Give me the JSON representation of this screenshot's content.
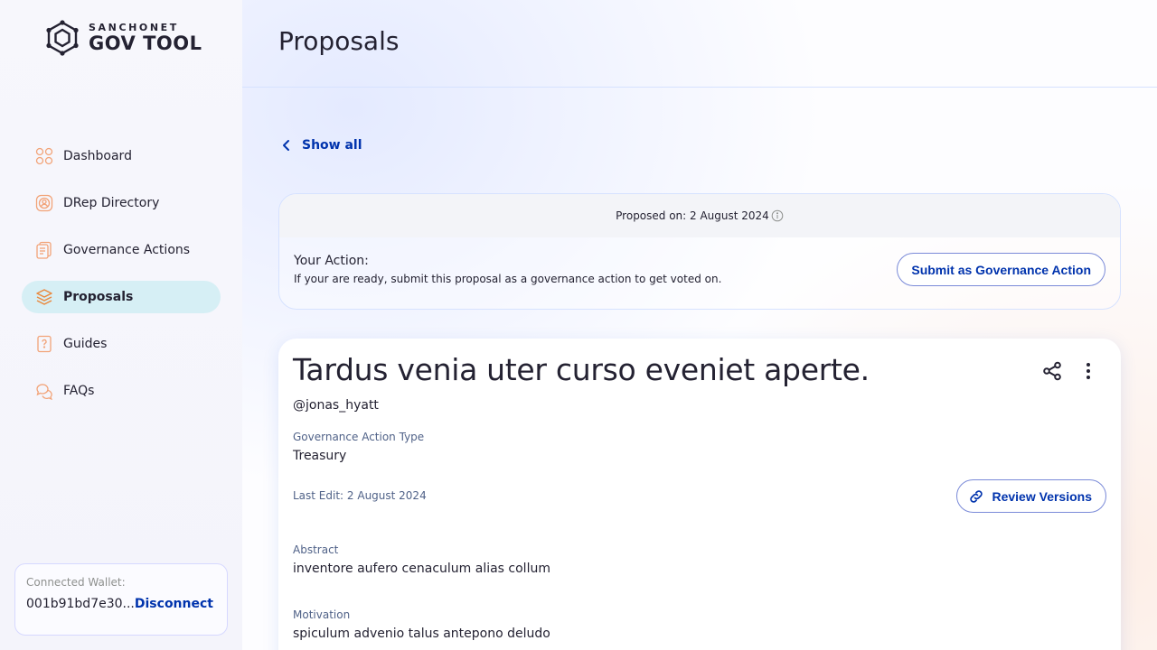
{
  "logo": {
    "subtitle": "SANCHONET",
    "title": "GOV TOOL"
  },
  "sidebar": {
    "items": [
      {
        "label": "Dashboard",
        "icon": "dashboard-icon"
      },
      {
        "label": "DRep Directory",
        "icon": "drep-directory-icon"
      },
      {
        "label": "Governance Actions",
        "icon": "governance-actions-icon"
      },
      {
        "label": "Proposals",
        "icon": "proposals-icon",
        "active": true
      },
      {
        "label": "Guides",
        "icon": "guides-icon"
      },
      {
        "label": "FAQs",
        "icon": "faqs-icon"
      }
    ]
  },
  "wallet": {
    "label": "Connected Wallet:",
    "address": "001b91bd7e30...",
    "disconnect": "Disconnect"
  },
  "header": {
    "title": "Proposals"
  },
  "back": {
    "label": "Show all"
  },
  "action_card": {
    "proposed_on": "Proposed on: 2 August 2024",
    "title": "Your Action:",
    "description": "If your are ready, submit this proposal as a governance action to get voted on.",
    "submit_label": "Submit as Governance Action"
  },
  "proposal": {
    "title": "Tardus venia uter curso eveniet aperte.",
    "author": "@jonas_hyatt",
    "type_label": "Governance Action Type",
    "type_value": "Treasury",
    "last_edit": "Last Edit: 2 August 2024",
    "review_label": "Review Versions",
    "abstract_label": "Abstract",
    "abstract_value": "inventore aufero cenaculum alias collum",
    "motivation_label": "Motivation",
    "motivation_value": "spiculum advenio talus antepono deludo"
  },
  "colors": {
    "accent": "#0033ad",
    "active_nav": "#d6eff5",
    "icon_orange": "#f2a378",
    "text": "#242232",
    "muted": "#506288"
  }
}
